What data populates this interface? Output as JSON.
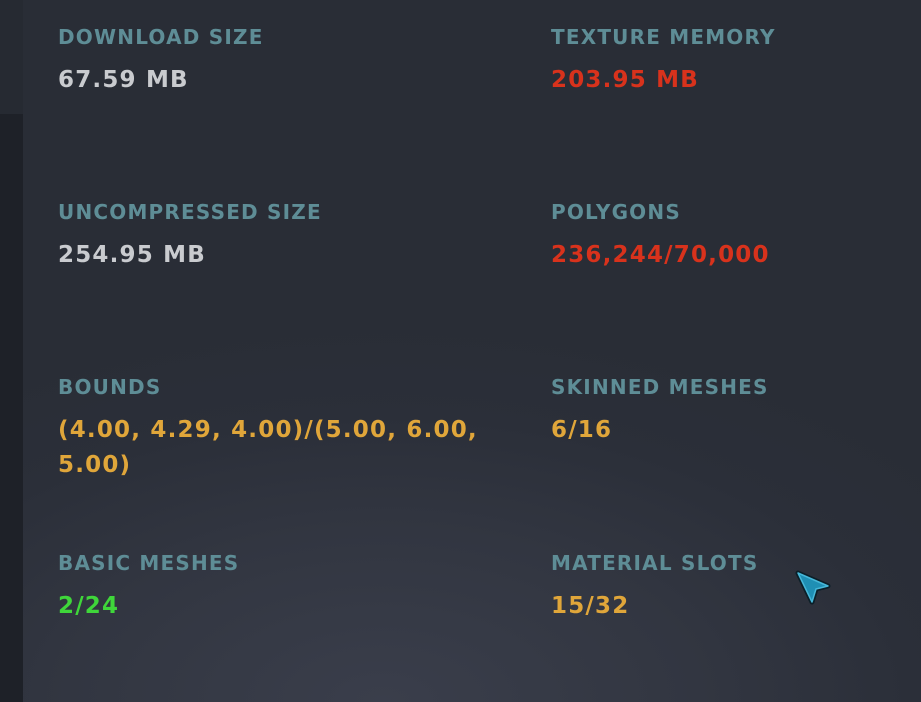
{
  "stats": {
    "download_size": {
      "label": "DOWNLOAD SIZE",
      "value": "67.59 MB",
      "color": "#c9cbcf"
    },
    "texture_memory": {
      "label": "TEXTURE MEMORY",
      "value": "203.95 MB",
      "color": "#d8321c"
    },
    "uncompressed_size": {
      "label": "UNCOMPRESSED SIZE",
      "value": "254.95 MB",
      "color": "#c9cbcf"
    },
    "polygons": {
      "label": "POLYGONS",
      "value": "236,244/70,000",
      "color": "#d8321c"
    },
    "bounds": {
      "label": "BOUNDS",
      "value": "(4.00, 4.29, 4.00)/(5.00, 6.00, 5.00)",
      "color": "#e0a63a"
    },
    "skinned_meshes": {
      "label": "SKINNED MESHES",
      "value": "6/16",
      "color": "#e0a63a"
    },
    "basic_meshes": {
      "label": "BASIC MESHES",
      "value": "2/24",
      "color": "#3fd63a"
    },
    "material_slots": {
      "label": "MATERIAL SLOTS",
      "value": "15/32",
      "color": "#e0a63a"
    }
  },
  "colors": {
    "label": "#5e8d96",
    "panel_bg": "#2d313b",
    "cursor": "#1f8fb4"
  },
  "icons": {
    "cursor": "cursor-arrow-icon"
  }
}
